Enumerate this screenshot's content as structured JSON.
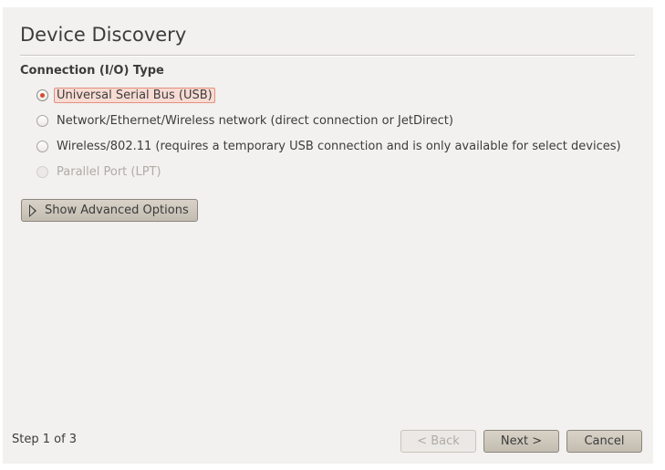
{
  "window": {
    "title": "Device Discovery"
  },
  "connection": {
    "label": "Connection (I/O) Type",
    "options": [
      {
        "label": "Universal Serial Bus (USB)",
        "selected": true,
        "enabled": true
      },
      {
        "label": "Network/Ethernet/Wireless network (direct connection or JetDirect)",
        "selected": false,
        "enabled": true
      },
      {
        "label": "Wireless/802.11 (requires a temporary USB connection and is only available for select devices)",
        "selected": false,
        "enabled": true
      },
      {
        "label": "Parallel Port (LPT)",
        "selected": false,
        "enabled": false
      }
    ]
  },
  "advanced": {
    "label": "Show Advanced Options",
    "icon": "expander-arrow-icon"
  },
  "footer": {
    "step": "Step 1 of 3",
    "back_label": "< Back",
    "next_label": "Next >",
    "cancel_label": "Cancel"
  },
  "colors": {
    "accent": "#d94a2f",
    "focus_bg": "#f8dcd4",
    "window_bg": "#f2f1f0"
  }
}
